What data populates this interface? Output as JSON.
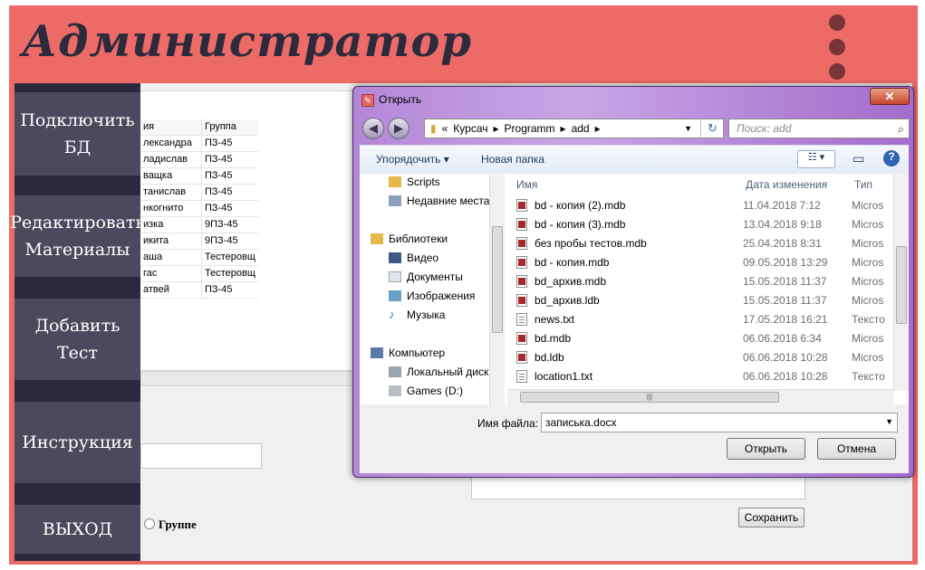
{
  "header": {
    "title": "Администратор"
  },
  "sidebar": {
    "items": [
      {
        "label": "Подключить\nБД"
      },
      {
        "label": "Редактировать\nМатериалы"
      },
      {
        "label": "Добавить\nТест"
      },
      {
        "label": "Инструкция"
      },
      {
        "label": "ВЫХОД"
      }
    ]
  },
  "grid": {
    "headers": [
      "ия",
      "Группа"
    ],
    "rows": [
      [
        "лександра",
        "ПЗ-45"
      ],
      [
        "ладислав",
        "ПЗ-45"
      ],
      [
        "ващка",
        "ПЗ-45"
      ],
      [
        "танислав",
        "ПЗ-45"
      ],
      [
        "нкогнито",
        "ПЗ-45"
      ],
      [
        "изка",
        "9ПЗ-45"
      ],
      [
        "икита",
        "9ПЗ-45"
      ],
      [
        "аша",
        "Тестеровщ"
      ],
      [
        "гас",
        "Тестеровщ"
      ],
      [
        "атвей",
        "ПЗ-45"
      ]
    ]
  },
  "form": {
    "radio_label": "Группе",
    "save_label": "Сохранить"
  },
  "dialog": {
    "title": "Открыть",
    "close_label": "✕",
    "path": [
      "«",
      "Курсач",
      "▸",
      "Programm",
      "▸",
      "add",
      "▸"
    ],
    "search_placeholder": "Поиск: add",
    "toolbar": {
      "organize": "Упорядочить ▾",
      "new_folder": "Новая папка"
    },
    "tree": [
      {
        "label": "Scripts",
        "icon": "folder-icon"
      },
      {
        "label": "Недавние места",
        "icon": "recent-places-icon"
      },
      {
        "label": "Библиотеки",
        "icon": "libraries-icon"
      },
      {
        "label": "Видео",
        "icon": "video-icon"
      },
      {
        "label": "Документы",
        "icon": "documents-icon"
      },
      {
        "label": "Изображения",
        "icon": "images-icon"
      },
      {
        "label": "Музыка",
        "icon": "music-icon"
      },
      {
        "label": "Компьютер",
        "icon": "computer-icon"
      },
      {
        "label": "Локальный диск",
        "icon": "local-disk-icon"
      },
      {
        "label": "Games (D:)",
        "icon": "drive-icon"
      }
    ],
    "columns": [
      "Имя",
      "Дата изменения",
      "Тип"
    ],
    "files": [
      {
        "name": "bd - копия (2).mdb",
        "date": "11.04.2018 7:12",
        "type": "Micros",
        "icon": "db"
      },
      {
        "name": "bd - копия (3).mdb",
        "date": "13.04.2018 9:18",
        "type": "Micros",
        "icon": "db"
      },
      {
        "name": "без пробы тестов.mdb",
        "date": "25.04.2018 8:31",
        "type": "Micros",
        "icon": "db"
      },
      {
        "name": "bd - копия.mdb",
        "date": "09.05.2018 13:29",
        "type": "Micros",
        "icon": "db"
      },
      {
        "name": "bd_архив.mdb",
        "date": "15.05.2018 11:37",
        "type": "Micros",
        "icon": "db"
      },
      {
        "name": "bd_архив.ldb",
        "date": "15.05.2018 11:37",
        "type": "Micros",
        "icon": "db"
      },
      {
        "name": "news.txt",
        "date": "17.05.2018 16:21",
        "type": "Тексто",
        "icon": "txt"
      },
      {
        "name": "bd.mdb",
        "date": "06.06.2018 6:34",
        "type": "Micros",
        "icon": "db"
      },
      {
        "name": "bd.ldb",
        "date": "06.06.2018 10:28",
        "type": "Micros",
        "icon": "db"
      },
      {
        "name": "location1.txt",
        "date": "06.06.2018 10:28",
        "type": "Тексто",
        "icon": "txt"
      }
    ],
    "filename_label": "Имя файла:",
    "filename_value": "записька.docx",
    "open_label": "Открыть",
    "cancel_label": "Отмена"
  },
  "colors": {
    "header_bg": "#ec6b67",
    "sidebar_bg": "#2a2a3c",
    "sidebar_button": "#4a4a5c"
  }
}
